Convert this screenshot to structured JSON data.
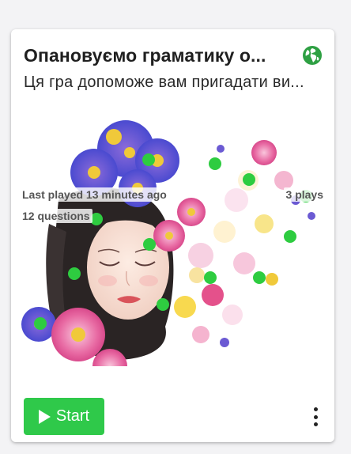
{
  "card": {
    "title": "Опановуємо граматику о...",
    "description": "Ця гра допоможе вам пригадати ви...",
    "icons": {
      "visibility": "globe-icon",
      "more": "more-vertical-icon",
      "play": "play-icon"
    },
    "meta": {
      "last_played": "Last played 13 minutes ago",
      "plays": "3 plays",
      "questions": "12 questions"
    },
    "start_label": "Start",
    "colors": {
      "accent_green": "#2fc94a",
      "globe_green": "#2ea043",
      "hotspot_green": "#2ecc40"
    },
    "image": {
      "subject": "watercolor illustration of a woman with flowers in her hair",
      "hotspot_count": 14
    }
  }
}
